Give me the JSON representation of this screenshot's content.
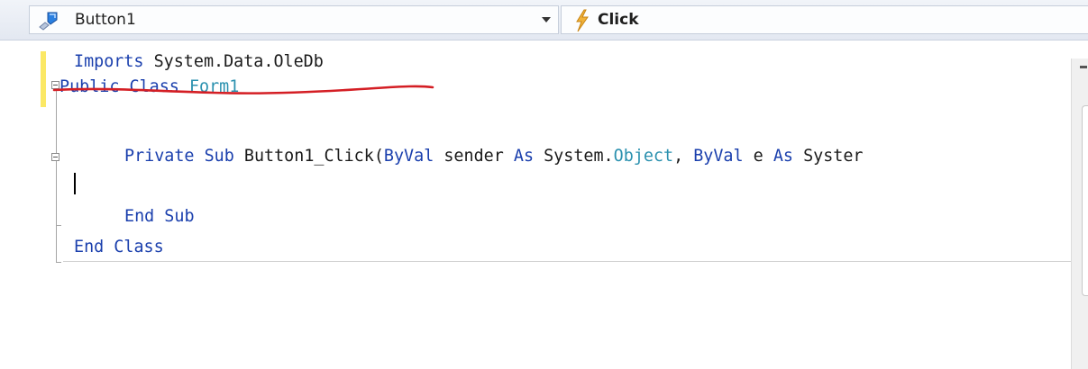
{
  "navbar": {
    "class_combo": {
      "value": "Button1",
      "icon": "class-object-icon"
    },
    "event_combo": {
      "value": "Click",
      "icon": "lightning-event-icon"
    }
  },
  "editor": {
    "lines": {
      "l1": {
        "kw": "Imports",
        "rest": " System.Data.OleDb"
      },
      "l2": {
        "kw_public": "Public",
        "kw_class": "Class",
        "type": "Form1"
      },
      "l4": {
        "kw_private": "Private",
        "kw_sub": "Sub",
        "name": "Button1_Click(",
        "kw_byval1": "ByVal",
        "sender": "sender",
        "kw_as1": "As",
        "ns1": "System.",
        "type_object": "Object",
        "comma": ",",
        "kw_byval2": "ByVal",
        "e": "e",
        "kw_as2": "As",
        "ns2": "Syster"
      },
      "l6": {
        "kw_end": "End",
        "kw_sub": "Sub"
      },
      "l7": {
        "kw_end": "End",
        "kw_class": "Class"
      }
    },
    "annotation_color": "#d41e24",
    "keyword_color": "#1a3fad",
    "type_color": "#2b91af"
  }
}
